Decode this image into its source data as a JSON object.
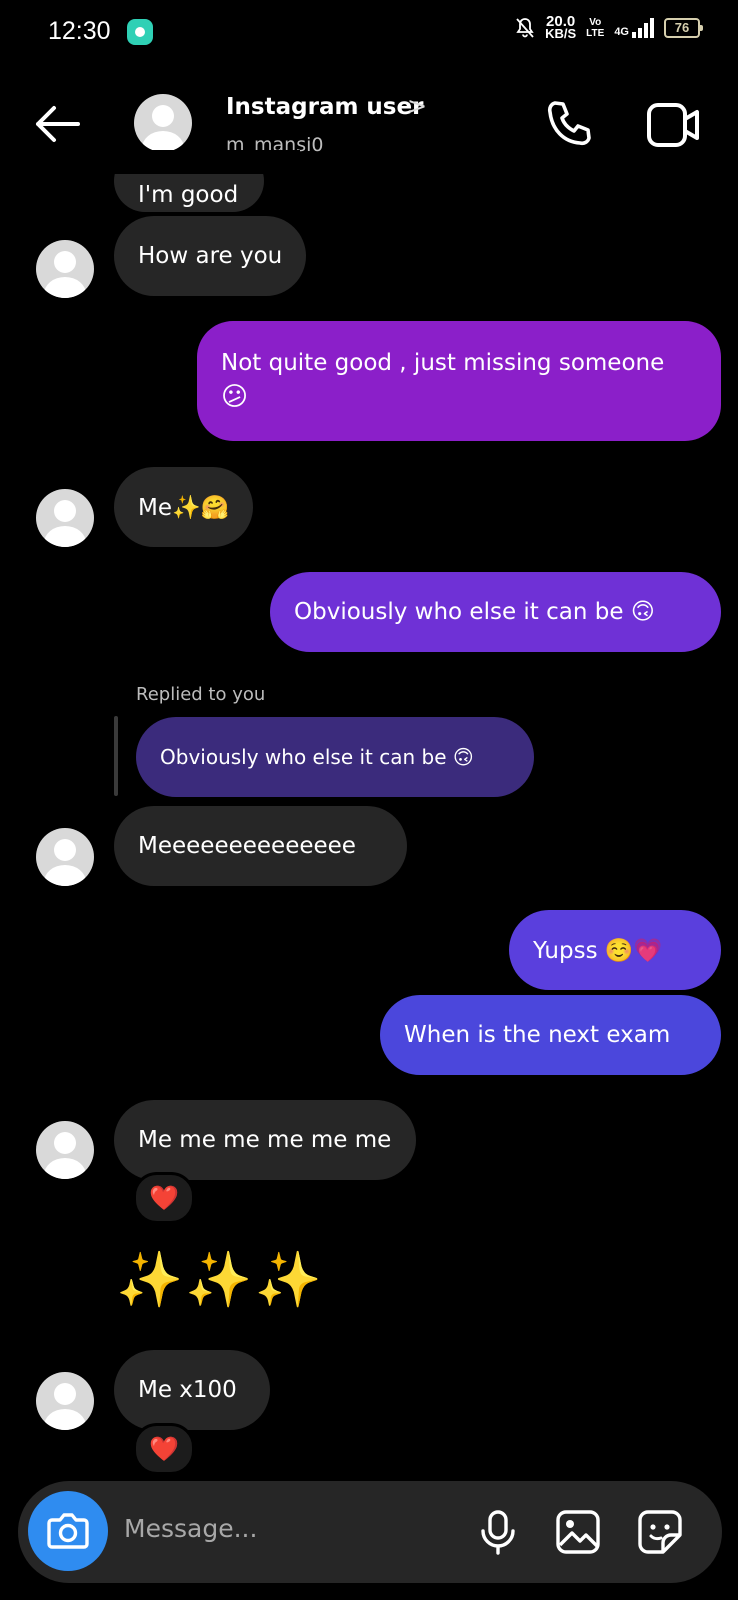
{
  "status_bar": {
    "time": "12:30",
    "speed_value": "20.0",
    "speed_unit": "KB/S",
    "volte_top": "Vo",
    "volte_bottom": "LTE",
    "network": "4G",
    "battery": "76"
  },
  "header": {
    "title": "Instagram user",
    "chevron": ">",
    "handle": "m_mansi0"
  },
  "messages": {
    "clipped_top": "I'm good",
    "m1": "How are you",
    "m2_line1": "Not quite good , just missing someone",
    "m2_line2": "😕",
    "m3": "Me✨🤗",
    "m4": "Obviously who else it can be 🙃",
    "reply_label": "Replied to you",
    "reply_quote": "Obviously who else it can be 🙃",
    "m5": "Meeeeeeeeeeeeee",
    "m6": "Yupss ☺️💗",
    "m7": "When is the next exam",
    "m8": "Me me me me me me",
    "m8_reaction": "❤️",
    "m9": "✨✨✨",
    "m10": "Me x100",
    "m10_reaction": "❤️"
  },
  "composer": {
    "placeholder": "Message..."
  },
  "colors": {
    "incoming_bubble": "#262626",
    "outgoing_purple": "#8b1fc9",
    "outgoing_violet": "#6f31d6",
    "outgoing_blue": "#4b47dc",
    "camera_button": "#2f8cf0"
  },
  "icons": {
    "back": "arrow-left-icon",
    "call": "phone-icon",
    "video": "video-camera-icon",
    "camera": "camera-icon",
    "mic": "microphone-icon",
    "gallery": "image-icon",
    "sticker": "sticker-icon"
  }
}
